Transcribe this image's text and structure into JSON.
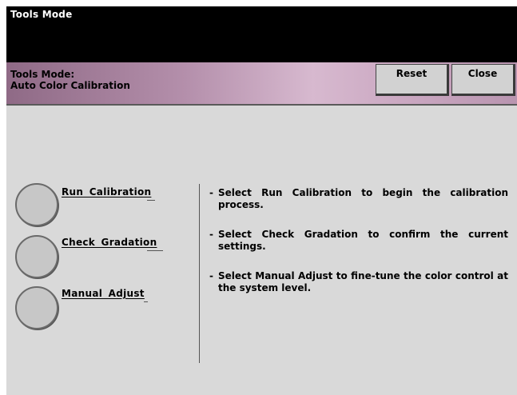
{
  "window": {
    "title": "Tools Mode"
  },
  "header": {
    "title_line1": "Tools Mode:",
    "title_line2": "Auto Color Calibration",
    "reset_label": "Reset",
    "close_label": "Close"
  },
  "options": [
    {
      "label": "Run Calibration"
    },
    {
      "label": "Check  Gradation"
    },
    {
      "label": "Manual  Adjust"
    }
  ],
  "instructions": [
    {
      "bullet": "-",
      "text": "Select Run Calibration to begin the calibration process."
    },
    {
      "bullet": "-",
      "text": "Select Check Gradation  to confirm the current settings."
    },
    {
      "bullet": "-",
      "text": "Select Manual Adjust to fine-tune the color control at the system level."
    }
  ]
}
